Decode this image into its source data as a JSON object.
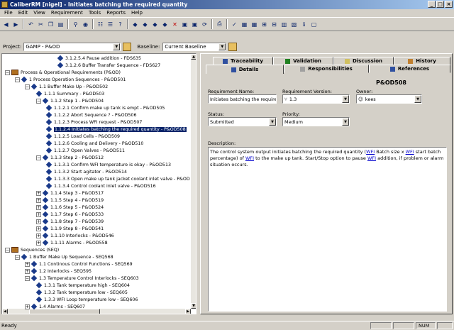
{
  "window": {
    "title": "CaliberRM [nigel] - Initiates batching the required quantity"
  },
  "menu": [
    "File",
    "Edit",
    "View",
    "Requirement",
    "Tools",
    "Reports",
    "Help"
  ],
  "project": {
    "label": "Project:",
    "value": "GAMP - P&OD",
    "baseline_label": "Baseline:",
    "baseline_value": "Current Baseline"
  },
  "tree": [
    {
      "text": "3.1.2.5.4 Pause addition - FDS635",
      "icon": "diamond-icon",
      "expander": ""
    },
    {
      "text": "3.1.2.6 Buffer Transfer Sequence - FDS627",
      "icon": "diamond-icon",
      "expander": ""
    },
    {
      "text": "Process & Operational Requirements (P&OD)",
      "icon": "book-icon",
      "expander": "−"
    },
    {
      "text": "1 Process Operation Sequences - P&OD501",
      "icon": "diamond-icon",
      "expander": "−"
    },
    {
      "text": "1.1 Buffer Make Up - P&OD502",
      "icon": "diamond-icon",
      "expander": "−"
    },
    {
      "text": "1.1.1 Summary - P&OD503",
      "icon": "diamond-icon",
      "expander": ""
    },
    {
      "text": "1.1.2 Step 1 - P&OD504",
      "icon": "diamond-icon",
      "expander": "−"
    },
    {
      "text": "1.1.2.1 Confirm make up tank is empt - P&OD505",
      "icon": "diamond-icon",
      "expander": ""
    },
    {
      "text": "1.1.2.2 Abort Sequence ? - P&OD506",
      "icon": "diamond-icon",
      "expander": ""
    },
    {
      "text": "1.1.2.3 Process WFI request - P&OD507",
      "icon": "diamond-icon",
      "expander": ""
    },
    {
      "text": "1.1.2.4 Initiates batching the required quantity - P&OD508",
      "icon": "diamond-icon",
      "expander": "",
      "selected": true
    },
    {
      "text": "1.1.2.5 Load Cells - P&OD509",
      "icon": "diamond-icon",
      "expander": ""
    },
    {
      "text": "1.1.2.6 Cooling and Delivery - P&OD510",
      "icon": "diamond-icon",
      "expander": ""
    },
    {
      "text": "1.1.2.7 Open Valves - P&OD511",
      "icon": "diamond-icon",
      "expander": ""
    },
    {
      "text": "1.1.3 Step 2 - P&OD512",
      "icon": "diamond-icon",
      "expander": "−"
    },
    {
      "text": "1.1.3.1 Confirm WFI temperature is okay - P&OD513",
      "icon": "diamond-icon",
      "expander": ""
    },
    {
      "text": "1.1.3.2 Start agitator - P&OD514",
      "icon": "diamond-icon",
      "expander": ""
    },
    {
      "text": "1.1.3.3 Open make up tank jacket coolant inlet valve - P&OD",
      "icon": "diamond-icon",
      "expander": ""
    },
    {
      "text": "1.1.3.4 Control coolant inlet valve - P&OD516",
      "icon": "diamond-icon",
      "expander": ""
    },
    {
      "text": "1.1.4 Step 3 - P&OD517",
      "icon": "diamond-icon",
      "expander": "+"
    },
    {
      "text": "1.1.5 Step 4 - P&OD519",
      "icon": "diamond-icon",
      "expander": "+"
    },
    {
      "text": "1.1.6 Step 5 - P&OD524",
      "icon": "diamond-icon",
      "expander": "+"
    },
    {
      "text": "1.1.7 Step 6 - P&OD533",
      "icon": "diamond-icon",
      "expander": "+"
    },
    {
      "text": "1.1.8 Step 7 - P&OD539",
      "icon": "diamond-icon",
      "expander": "+"
    },
    {
      "text": "1.1.9 Step 8 - P&OD541",
      "icon": "diamond-icon",
      "expander": "+"
    },
    {
      "text": "1.1.10 Interlocks - P&OD546",
      "icon": "diamond-icon",
      "expander": "+"
    },
    {
      "text": "1.1.11 Alarms - P&OD558",
      "icon": "diamond-icon",
      "expander": "+"
    },
    {
      "text": "Sequences (SEQ)",
      "icon": "book-icon",
      "expander": "−"
    },
    {
      "text": "1 Buffer Make Up Sequence - SEQ568",
      "icon": "diamond-icon",
      "expander": "−"
    },
    {
      "text": "1.1 Continous Control Functions - SEQ569",
      "icon": "diamond-icon",
      "expander": "+"
    },
    {
      "text": "1.2 Interlocks - SEQ595",
      "icon": "diamond-icon",
      "expander": "+"
    },
    {
      "text": "1.3 Temperature Control Interlocks - SEQ603",
      "icon": "diamond-icon",
      "expander": "−"
    },
    {
      "text": "1.3.1 Tank temperature high - SEQ604",
      "icon": "diamond-icon",
      "expander": ""
    },
    {
      "text": "1.3.2 Tank temperature low - SEQ605",
      "icon": "diamond-icon",
      "expander": ""
    },
    {
      "text": "1.3.3 WFI Loop temperature low - SEQ606",
      "icon": "diamond-icon",
      "expander": ""
    },
    {
      "text": "1.4 Alarms - SEQ607",
      "icon": "diamond-icon",
      "expander": "+"
    }
  ],
  "tabs_row1": [
    "Traceability",
    "Validation",
    "Discussion",
    "History"
  ],
  "tabs_row2": [
    "Details",
    "Responsibilities",
    "References"
  ],
  "details": {
    "req_id": "P&OD508",
    "name_label": "Requirement Name:",
    "name_value": "Initiates batching the required",
    "version_label": "Requirement Version:",
    "version_value": "1.3",
    "owner_label": "Owner:",
    "owner_value": "kees",
    "status_label": "Status:",
    "status_value": "Submitted",
    "priority_label": "Priority:",
    "priority_value": "Medium",
    "description_label": "Description:",
    "description_parts": [
      {
        "t": "The control system output initiates batching the required quantity (",
        "link": false
      },
      {
        "t": "WFI",
        "link": true
      },
      {
        "t": " Batch size x ",
        "link": false
      },
      {
        "t": "WFI",
        "link": true
      },
      {
        "t": " start batch percentage) of ",
        "link": false
      },
      {
        "t": "WFI",
        "link": true
      },
      {
        "t": " to the make up tank. Start/Stop option to pause ",
        "link": false
      },
      {
        "t": "WFI",
        "link": true
      },
      {
        "t": " addition, if problem or alarm situation occurs.",
        "link": false
      }
    ]
  },
  "status": {
    "text": "Ready",
    "num": "NUM"
  }
}
